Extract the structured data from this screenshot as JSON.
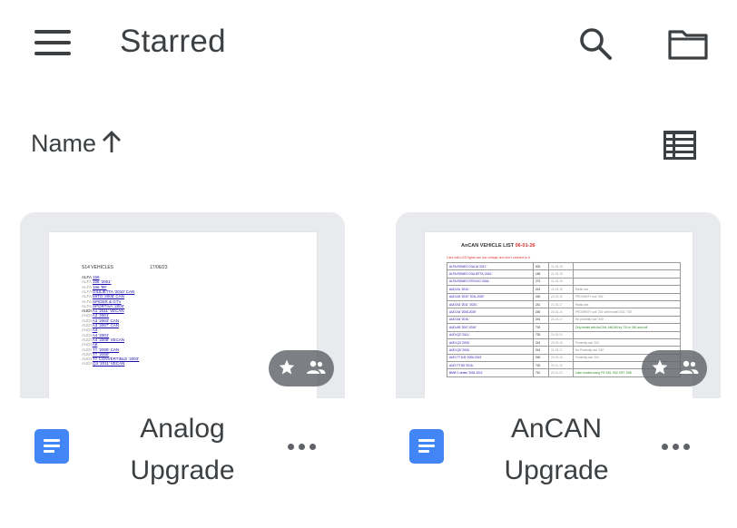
{
  "appbar": {
    "menu_icon": "hamburger-menu-icon",
    "title": "Starred",
    "search_icon": "search-icon",
    "folder_icon": "folder-icon"
  },
  "sort": {
    "label": "Name",
    "direction_icon": "arrow-up-icon",
    "view_toggle_icon": "list-view-icon"
  },
  "files": [
    {
      "name": "Analog Upgrade",
      "type_icon": "google-docs-icon",
      "starred": true,
      "shared": true,
      "more_icon": "more-horizontal-icon",
      "thumbnail": {
        "heading": "S14 VEHICLES",
        "date": "17/06/23",
        "lines": [
          {
            "make": "ALFA",
            "model": "156",
            "dark": true
          },
          {
            "make": "ALFA",
            "model": "156 '2001'",
            "dark": false
          },
          {
            "make": "ALFA",
            "model": "166 '99'",
            "dark": false
          },
          {
            "make": "ALFA",
            "model": "GIULIETTA '2010' CAN",
            "dark": false
          },
          {
            "make": "ALFA",
            "model": "MITO '2008' CAN",
            "dark": false
          },
          {
            "make": "ALFA",
            "model": "SPIDER & GTV",
            "dark": false
          },
          {
            "make": "ALFA",
            "model": "SPORTIVA '2000'",
            "dark": false
          },
          {
            "make": "AUDI",
            "model": "A1 '2011' VECAN",
            "dark": true
          },
          {
            "make": "AUDI",
            "model": "A3 '2001'",
            "dark": false
          },
          {
            "make": "AUDI",
            "model": "A3 '2003' CAN",
            "dark": false
          },
          {
            "make": "AUDI",
            "model": "A3 '2007' CAN",
            "dark": false
          },
          {
            "make": "AUDI",
            "model": "A4",
            "dark": false
          },
          {
            "make": "AUDI",
            "model": "A4 '2001'",
            "dark": false
          },
          {
            "make": "AUDI",
            "model": "A4 '2008' VECAN",
            "dark": false
          },
          {
            "make": "AUDI",
            "model": "A6",
            "dark": false
          },
          {
            "make": "AUDI",
            "model": "TT '2006' CAN",
            "dark": false
          },
          {
            "make": "AUDI",
            "model": "TT '2008'",
            "dark": false
          },
          {
            "make": "AUDI",
            "model": "TT CONVERTIBLE '2003'",
            "dark": false
          },
          {
            "make": "AUDI",
            "model": "Q3 '2011' VECAN",
            "dark": false
          }
        ]
      }
    },
    {
      "name": "AnCAN Upgrade",
      "type_icon": "google-docs-icon",
      "starred": true,
      "shared": true,
      "more_icon": "more-horizontal-icon",
      "thumbnail": {
        "heading": "AnCAN VEHICLE LIST",
        "heading_date": "06-01-26",
        "subtitle": "Cars with LED lights use low voltage and don't connect to it.",
        "rows": [
          [
            "ALFA ROMEO GIULIA '2017-'",
            "502",
            "21-03-19",
            ""
          ],
          [
            "ALFA ROMEO GIULIETTA '2010-'",
            "165",
            "21-03-19",
            ""
          ],
          [
            "ALFA ROMEO STELVIO '2016-'",
            "272",
            "21-03-19",
            ""
          ],
          [
            "AUDI A1 '2010-'",
            "241",
            "21-03-10",
            "Radio use"
          ],
          [
            "AUDI A3 '2010' '2011-2020'",
            "240",
            "20-03-12",
            "PROXIMITY use '241'"
          ],
          [
            "AUDI A3 '2011' '2020-'",
            "241",
            "21-03-17",
            "Radio use"
          ],
          [
            "AUDI A4 '2008-2015'",
            "240",
            "20-03-10",
            "PROXIMITY use '241' with model 2011 '730'"
          ],
          [
            "AUDI A4 '2016-'",
            "241",
            "21-03-17",
            "No proximity use '240'"
          ],
          [
            "AUDI A5 '2007-2016'",
            "720",
            "",
            "Only tested with AnCAN, ANCAN try 720 or 240 and call"
          ],
          [
            "AUDI Q2 '2011-'",
            "720",
            "20-03-20",
            ""
          ],
          [
            "AUDI Q3 '2018-'",
            "241",
            "20-03-10",
            "Proximity use '241'"
          ],
          [
            "AUDI Q5 '2018-'",
            "241",
            "21-03-17",
            "No Proximity use '240'"
          ],
          [
            "AUDI TT 8J3 '2006-2013'",
            "240",
            "20-03-10",
            "Proximity use '241'"
          ],
          [
            "AUDI TT 8S '2015-'",
            "720",
            "20-12-10",
            ""
          ],
          [
            "BMW 1 series '2004-2011'",
            "710",
            "20-10-03",
            "Later models using 'F#' E81, E82, E87, E88"
          ]
        ]
      }
    }
  ],
  "colors": {
    "docs_blue": "#4285f4",
    "card_bg": "#e8eaed",
    "text": "#3c4043",
    "badge_bg": "#5f6368",
    "link_blue": "#1a0dab"
  }
}
